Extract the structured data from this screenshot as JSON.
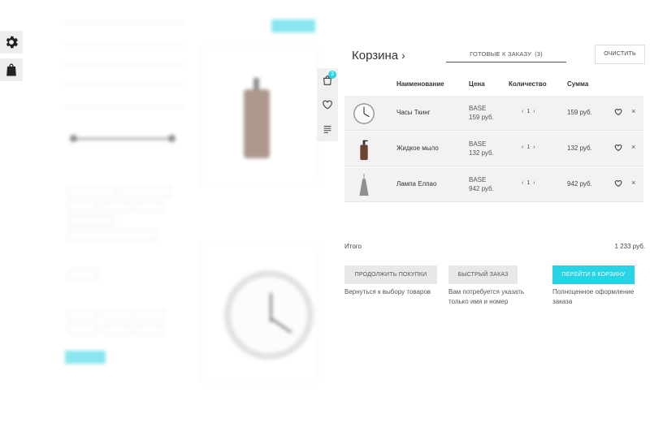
{
  "side_icons": [
    {
      "name": "gear-icon"
    },
    {
      "name": "shopping-bag-icon"
    }
  ],
  "panel_tabs": {
    "cart_badge": "3",
    "items": [
      {
        "name": "tab-cart-icon"
      },
      {
        "name": "tab-favorites-icon"
      },
      {
        "name": "tab-compare-icon"
      }
    ]
  },
  "cart": {
    "title": "Корзина",
    "chevron": "›",
    "ready_tab_label": "Готовые к заказу",
    "ready_tab_count": "(3)",
    "clear_label": "Очистить",
    "columns": {
      "name": "Наименование",
      "price": "Цена",
      "qty": "Количество",
      "sum": "Сумма"
    },
    "items": [
      {
        "name": "Часы Ткинг",
        "price_type": "BASE",
        "price": "159 руб.",
        "qty": "1",
        "sum": "159 руб.",
        "thumb": "clock-thumb"
      },
      {
        "name": "Жидкое мыло",
        "price_type": "BASE",
        "price": "132 руб.",
        "qty": "1",
        "sum": "132 руб.",
        "thumb": "soap-thumb"
      },
      {
        "name": "Лампа Елпао",
        "price_type": "BASE",
        "price": "942 руб.",
        "qty": "1",
        "sum": "942 руб.",
        "thumb": "lamp-thumb"
      }
    ],
    "qty_minus": "‹",
    "qty_plus": "›",
    "remove_symbol": "×",
    "total_label": "Итого",
    "total_value": "1 233 руб.",
    "actions": [
      {
        "label": "Продолжить покупки",
        "note": "Вернуться к выбору товаров"
      },
      {
        "label": "Быстрый заказ",
        "note": "Вам потребуется указать только имя и номер"
      },
      {
        "label": "Перейти в корзину",
        "note": "Полноценное оформление заказа"
      }
    ]
  },
  "colors": {
    "accent": "#29d3e6",
    "row_bg": "#f2f2f2",
    "text": "#333333"
  }
}
